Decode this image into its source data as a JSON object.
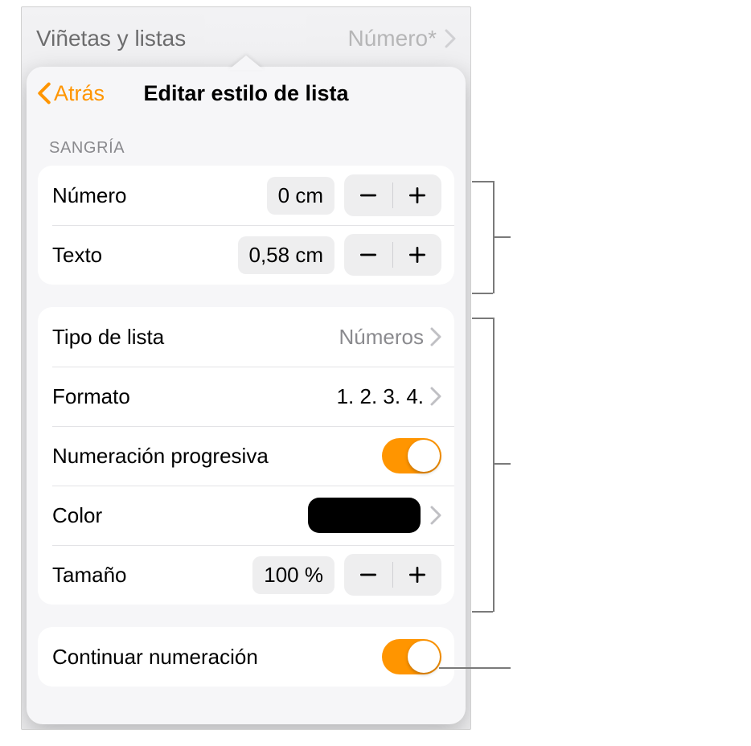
{
  "behind": {
    "title": "Viñetas y listas",
    "value": "Número*"
  },
  "nav": {
    "back": "Atrás",
    "title": "Editar estilo de lista"
  },
  "sections": {
    "indent_label": "SANGRÍA"
  },
  "indent": {
    "number_label": "Número",
    "number_value": "0 cm",
    "text_label": "Texto",
    "text_value": "0,58 cm"
  },
  "list": {
    "type_label": "Tipo de lista",
    "type_value": "Números",
    "format_label": "Formato",
    "format_value": "1. 2. 3. 4.",
    "progressive_label": "Numeración progresiva",
    "progressive_on": true,
    "color_label": "Color",
    "color_value": "#000000",
    "size_label": "Tamaño",
    "size_value": "100 %"
  },
  "continue": {
    "label": "Continuar numeración",
    "on": true
  }
}
